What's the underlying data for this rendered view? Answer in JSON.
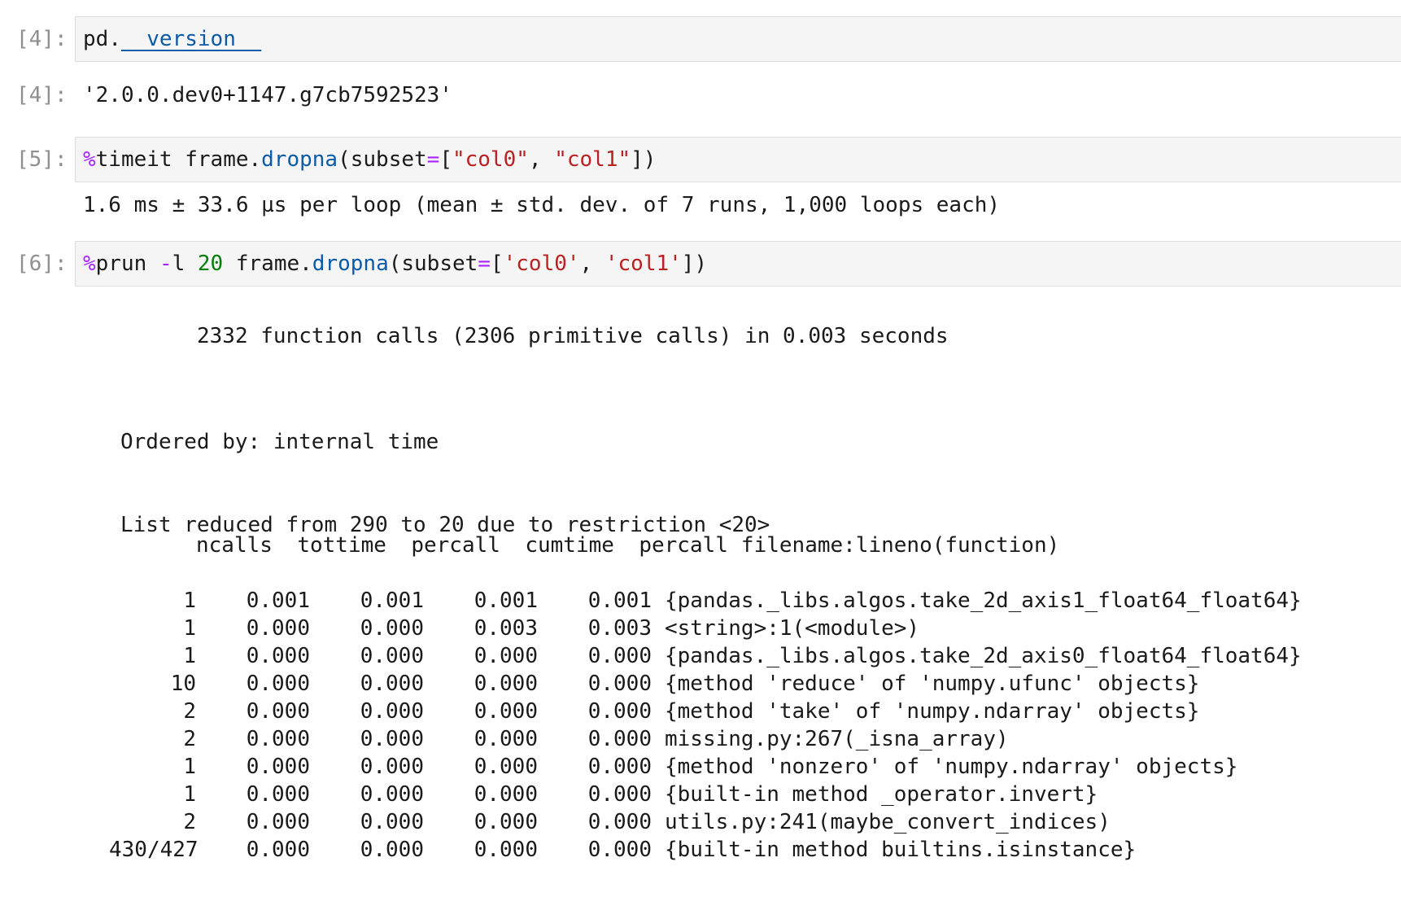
{
  "cells": {
    "c4": {
      "in_prompt": "[4]:",
      "code": {
        "obj": "pd",
        "dot": ".",
        "attr": "__version__"
      },
      "out_prompt": "[4]:",
      "output": "'2.0.0.dev0+1147.g7cb7592523'"
    },
    "c5": {
      "in_prompt": "[5]:",
      "code": {
        "magic": "%",
        "cmd": "timeit frame",
        "dot": ".",
        "method": "dropna",
        "p1": "(subset",
        "eq": "=",
        "p2": "[",
        "s1": "\"col0\"",
        "comma": ", ",
        "s2": "\"col1\"",
        "p3": "])"
      },
      "output": "1.6 ms ± 33.6 µs per loop (mean ± std. dev. of 7 runs, 1,000 loops each)"
    },
    "c6": {
      "in_prompt": "[6]:",
      "code": {
        "magic": "%",
        "cmd": "prun ",
        "flag_op": "-",
        "flag": "l ",
        "num": "20",
        "obj": " frame",
        "dot": ".",
        "method": "dropna",
        "p1": "(subset",
        "eq": "=",
        "p2": "[",
        "s1": "'col0'",
        "comma": ", ",
        "s2": "'col1'",
        "p3": "])"
      },
      "summary": "2332 function calls (2306 primitive calls) in 0.003 seconds",
      "ordered_by": "Ordered by: internal time",
      "list_reduced": "List reduced from 290 to 20 due to restriction <20>",
      "headers": [
        "ncalls",
        "tottime",
        "percall",
        "cumtime",
        "percall",
        "filename:lineno(function)"
      ],
      "rows": [
        [
          "1",
          "0.001",
          "0.001",
          "0.001",
          "0.001",
          "{pandas._libs.algos.take_2d_axis1_float64_float64}"
        ],
        [
          "1",
          "0.000",
          "0.000",
          "0.003",
          "0.003",
          "<string>:1(<module>)"
        ],
        [
          "1",
          "0.000",
          "0.000",
          "0.000",
          "0.000",
          "{pandas._libs.algos.take_2d_axis0_float64_float64}"
        ],
        [
          "10",
          "0.000",
          "0.000",
          "0.000",
          "0.000",
          "{method 'reduce' of 'numpy.ufunc' objects}"
        ],
        [
          "2",
          "0.000",
          "0.000",
          "0.000",
          "0.000",
          "{method 'take' of 'numpy.ndarray' objects}"
        ],
        [
          "2",
          "0.000",
          "0.000",
          "0.000",
          "0.000",
          "missing.py:267(_isna_array)"
        ],
        [
          "1",
          "0.000",
          "0.000",
          "0.000",
          "0.000",
          "{method 'nonzero' of 'numpy.ndarray' objects}"
        ],
        [
          "1",
          "0.000",
          "0.000",
          "0.000",
          "0.000",
          "{built-in method _operator.invert}"
        ],
        [
          "2",
          "0.000",
          "0.000",
          "0.000",
          "0.000",
          "utils.py:241(maybe_convert_indices)"
        ],
        [
          "430/427",
          "0.000",
          "0.000",
          "0.000",
          "0.000",
          "{built-in method builtins.isinstance}"
        ]
      ]
    }
  }
}
